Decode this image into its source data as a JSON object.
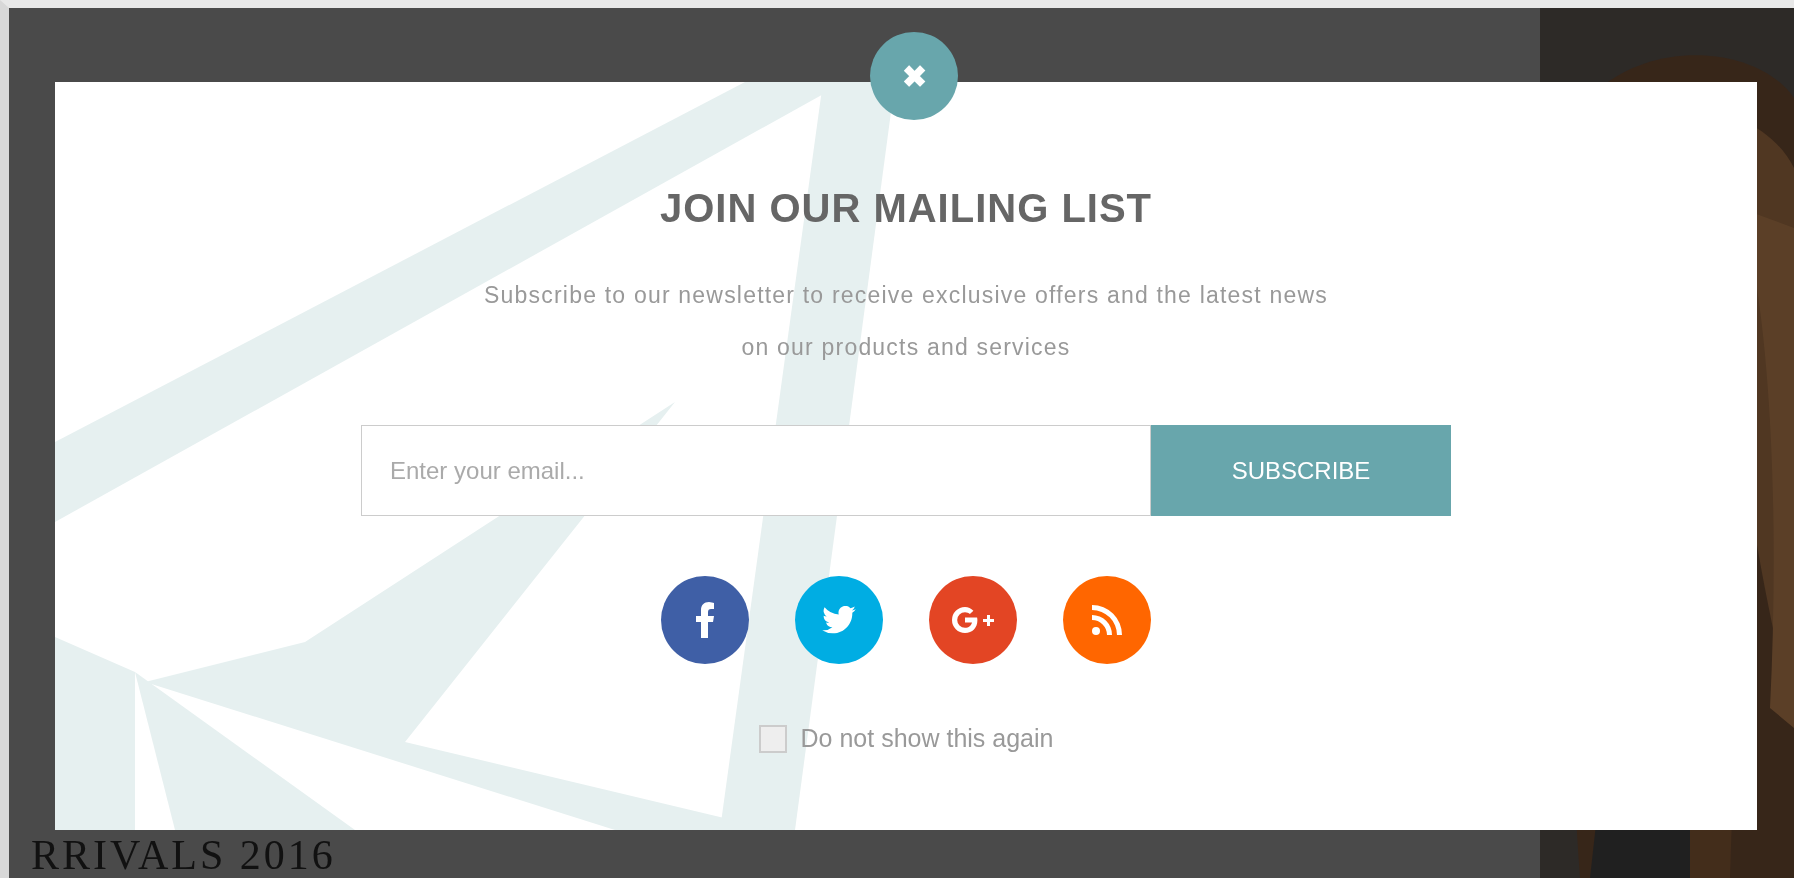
{
  "page": {
    "heading": "RRIVALS 2016"
  },
  "popup": {
    "close_label": "✖",
    "title": "JOIN OUR MAILING LIST",
    "description": "Subscribe to our newsletter to receive exclusive offers and the latest news on our products and services",
    "email": {
      "placeholder": "Enter your email..."
    },
    "subscribe_button": "SUBSCRIBE",
    "social": [
      {
        "kind": "facebook",
        "color": "#3f5fa6"
      },
      {
        "kind": "twitter",
        "color": "#00ade3"
      },
      {
        "kind": "googleplus",
        "color": "#e34524"
      },
      {
        "kind": "rss",
        "color": "#ff6600"
      }
    ],
    "dont_show": {
      "label": "Do not show this again",
      "checked": false
    }
  }
}
